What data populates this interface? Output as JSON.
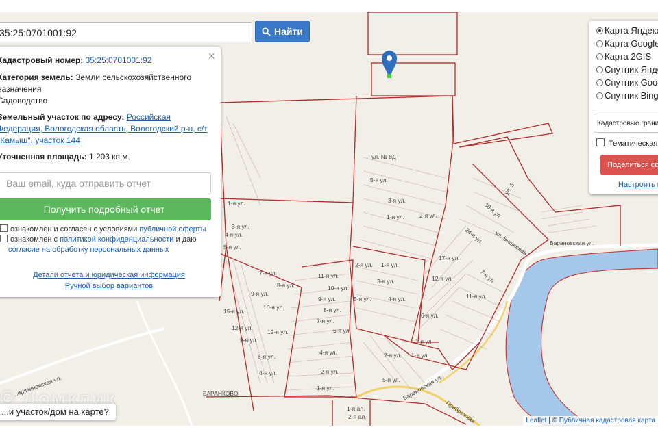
{
  "search": {
    "value": "35:25:0701001:92",
    "button_label": "Найти"
  },
  "info": {
    "cadastral_label": "Кадастровый номер:",
    "cadastral_value": "35:25:0701001:92",
    "category_label": "Категория земель:",
    "category_value": "Земли сельскохозяйственного назначения",
    "use_value": "Садоводство",
    "address_label": "Земельный участок по адресу:",
    "address_value": "Российская Федерация, Вологодская область, Вологодский р-н, с/т \"Камыш\", участок 144",
    "area_label": "Уточненная площадь:",
    "area_value": "1 203 кв.м.",
    "email_placeholder": "Ваш email, куда отправить отчет",
    "report_button": "Получить подробный отчет",
    "consent1_text": "ознакомлен и согласен с условиями ",
    "consent1_link": "публичной оферты",
    "consent2_text": "ознакомлен с ",
    "consent2_link": "политикой конфиденциальности",
    "consent2_tail": " и даю",
    "consent2_link2": "согласие на обработку персональных данных",
    "details_link": "Детали отчета и юридическая информация",
    "manual_link": "Ручной выбор вариантов"
  },
  "layers": {
    "options": [
      "Карта Яндекс",
      "Карта Google",
      "Карта 2GIS",
      "Спутник Яндекс",
      "Спутник Google",
      "Спутник Bing"
    ],
    "selected_index": 0,
    "select_value": "Кадастровые границы",
    "thematic_label": "Тематическая карта",
    "share_button": "Поделиться ссылкой",
    "setup_link": "Настроить карту"
  },
  "map_labels": {
    "street_baranovskaya": "Барановская ул.",
    "street_baranovskaya2": "Барановская ул.",
    "village": "БАРАНКОВО",
    "street_vishnevaya": "ул. Вишневая",
    "street_8d": "ул. № 8Д",
    "street_5": "ул. 5",
    "street_30": "30-я ул.",
    "street_24": "24-я ул.",
    "street_17": "17-я ул.",
    "street_12": "12-я ул.",
    "street_7": "7-я ул.",
    "street_11": "11-я ул.",
    "street_6": "6-я ул.",
    "street_1": "1-я ул.",
    "street_prib": "Прибрежная",
    "street_mira": "...ирязиновская ул."
  },
  "question": "...и участок/дом на карте?",
  "watermark": "© Домклик",
  "attribution": {
    "leaflet": "Leaflet",
    "sep": " | © ",
    "pkk": "Публичная кадастровая карта"
  }
}
